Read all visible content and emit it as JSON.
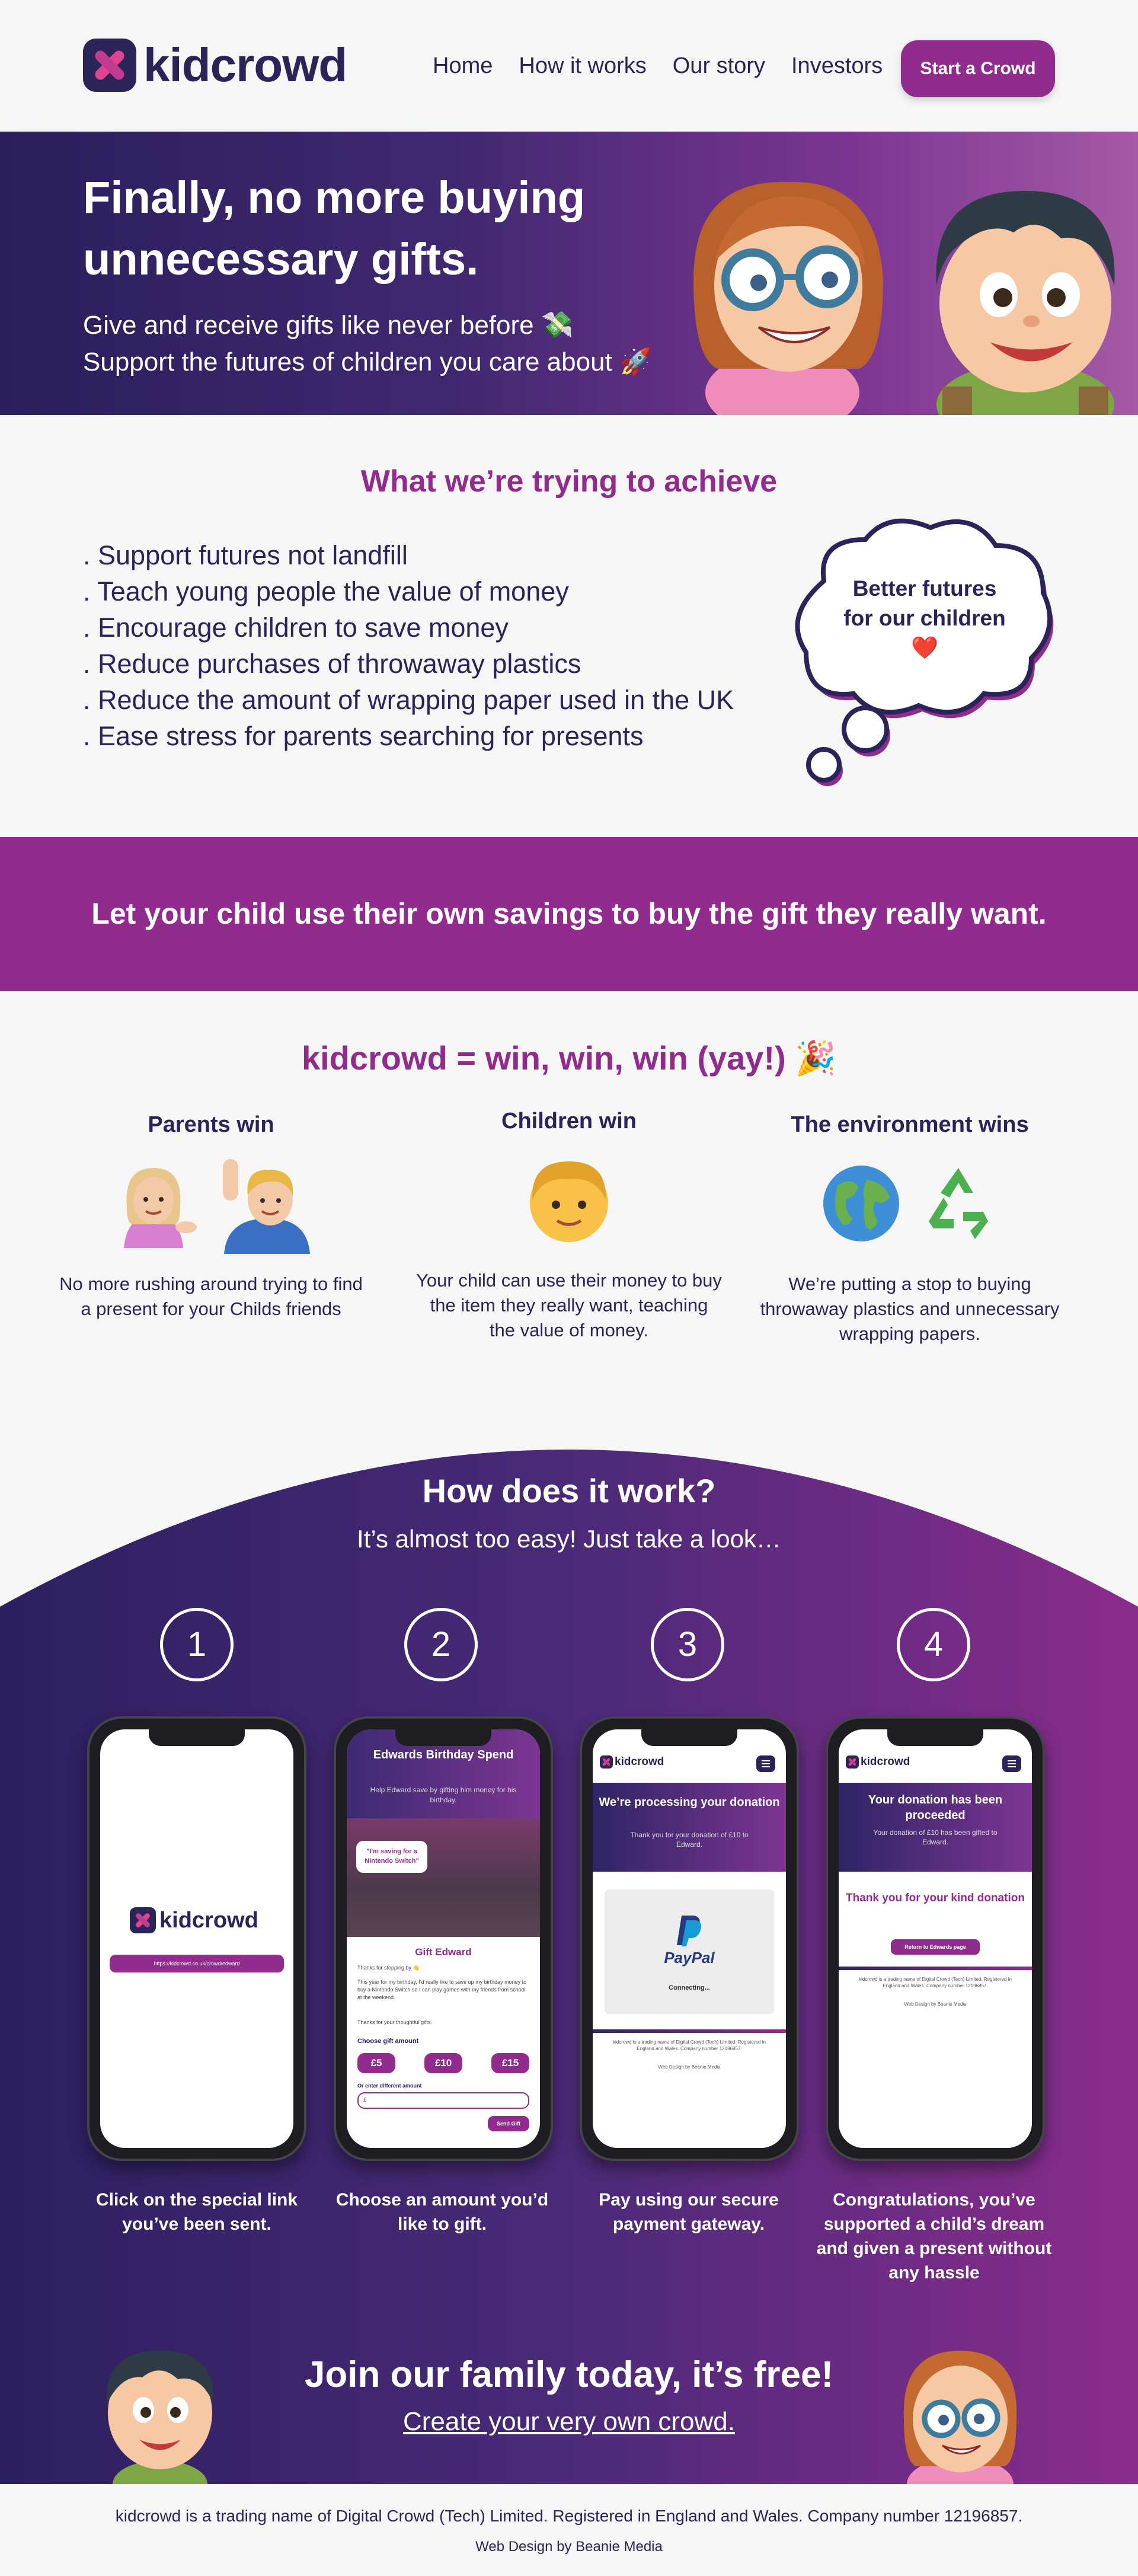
{
  "brand": {
    "name": "kidcrowd",
    "primary_color": "#2b2459",
    "accent_color": "#922b8e"
  },
  "nav": {
    "items": [
      "Home",
      "How it works",
      "Our story",
      "Investors"
    ],
    "cta": "Start a Crowd"
  },
  "hero": {
    "title": "Finally, no more buying unnecessary gifts.",
    "line1": "Give and receive gifts like never before 💸",
    "line2": "Support the futures of children you care about 🚀"
  },
  "achieve": {
    "title": "What we’re trying to achieve",
    "items": [
      ". Support futures not landfill",
      ". Teach young people the value of money",
      ". Encourage children to save money",
      ". Reduce purchases of throwaway plastics",
      ". Reduce the amount of wrapping paper used in the UK",
      ". Ease stress for parents searching for presents"
    ],
    "bubble_line1": "Better futures",
    "bubble_line2": "for our children",
    "bubble_icon": "❤️"
  },
  "banner": {
    "text": "Let your child use their own savings to buy the gift they really want."
  },
  "win": {
    "title": "kidcrowd = win, win, win (yay!) 🎉",
    "columns": [
      {
        "heading": "Parents win",
        "text": "No more rushing around trying to find a present for your Childs friends",
        "icons": [
          "person-tipping-hand-icon",
          "person-raising-hand-icon"
        ]
      },
      {
        "heading": "Children win",
        "text": "Your child can use their money to buy the item they really want, teaching the value of money.",
        "icons": [
          "child-icon"
        ]
      },
      {
        "heading": "The environment wins",
        "text": "We’re putting a stop to buying throwaway plastics and unnecessary wrapping papers.",
        "icons": [
          "globe-icon",
          "recycle-icon"
        ]
      }
    ]
  },
  "how": {
    "title": "How does it work?",
    "subtitle": "It’s almost too easy! Just take a look…",
    "steps": [
      {
        "number": "1",
        "caption": "Click on the special link you’ve been sent."
      },
      {
        "number": "2",
        "caption": "Choose an amount you’d like to gift."
      },
      {
        "number": "3",
        "caption": "Pay using our secure payment gateway."
      },
      {
        "number": "4",
        "caption": "Congratulations, you’ve supported a child’s dream and given a present without any hassle"
      }
    ],
    "phone1": {
      "logo": "kidcrowd",
      "link": "https://kidcrowd.co.uk/crowd/edward"
    },
    "phone2": {
      "title": "Edwards Birthday Spend",
      "subtitle": "Help Edward save by gifting him money for his birthday.",
      "speech": "\"I'm saving for a Nintendo Switch\"",
      "gift_heading": "Gift Edward",
      "thanks": "Thanks for stopping by 👋",
      "body": "This year for my birthday, I'd really like to save up my birthday money to buy a Nintendo Switch so I can play games with my friends from school at the weekend.",
      "thanks2": "Thanks for your thoughtful gifts.",
      "choose": "Choose gift amount",
      "amounts": [
        "£5",
        "£10",
        "£15"
      ],
      "or_enter": "Or enter different amount",
      "input_placeholder": "£",
      "send": "Send Gift"
    },
    "phone3": {
      "logo": "kidcrowd",
      "title": "We’re processing your donation",
      "subtitle": "Thank you for your donation of £10 to Edward.",
      "paypal": "PayPal",
      "connecting": "Connecting...",
      "footer": "kidcrowd is a trading name of Digital Crowd (Tech) Limited. Registered in England and Wales. Company number 12196857.",
      "credit": "Web Design by Beanie Media"
    },
    "phone4": {
      "logo": "kidcrowd",
      "title": "Your donation has been proceeded",
      "subtitle": "Your donation of £10 has been gifted to Edward.",
      "thanks": "Thank you for your kind donation",
      "return": "Return to Edwards page",
      "footer": "kidcrowd is a trading name of Digital Crowd (Tech) Limited. Registered in England and Wales. Company number 12196857.",
      "credit": "Web Design by Beanie Media"
    }
  },
  "join": {
    "title": "Join our family today, it’s free!",
    "link": "Create your very own crowd."
  },
  "footer": {
    "main": "kidcrowd is a trading name of Digital Crowd (Tech) Limited. Registered in England and Wales. Company number 12196857.",
    "credit": "Web Design by Beanie Media"
  }
}
